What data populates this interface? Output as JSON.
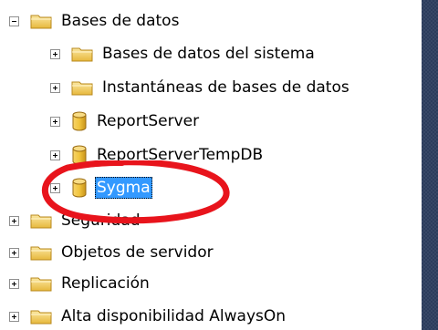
{
  "tree": {
    "items": [
      {
        "label": "Bases de datos",
        "icon": "folder",
        "expander": "minus"
      },
      {
        "label": "Bases de datos del sistema",
        "icon": "folder",
        "expander": "plus"
      },
      {
        "label": "Instantáneas de bases de datos",
        "icon": "folder",
        "expander": "plus"
      },
      {
        "label": "ReportServer",
        "icon": "database",
        "expander": "plus"
      },
      {
        "label": "ReportServerTempDB",
        "icon": "database",
        "expander": "plus"
      },
      {
        "label": "Sygma",
        "icon": "database",
        "expander": "plus",
        "selected": true
      },
      {
        "label": "Seguridad",
        "icon": "folder",
        "expander": "plus"
      },
      {
        "label": "Objetos de servidor",
        "icon": "folder",
        "expander": "plus"
      },
      {
        "label": "Replicación",
        "icon": "folder",
        "expander": "plus"
      },
      {
        "label": "Alta disponibilidad AlwaysOn",
        "icon": "folder",
        "expander": "plus"
      }
    ]
  },
  "colors": {
    "selection": "#3399ff",
    "highlight_circle": "#e8141c",
    "splitter": "#2b3c5c",
    "folder": "#f3cf5c",
    "database": "#e8b222"
  }
}
